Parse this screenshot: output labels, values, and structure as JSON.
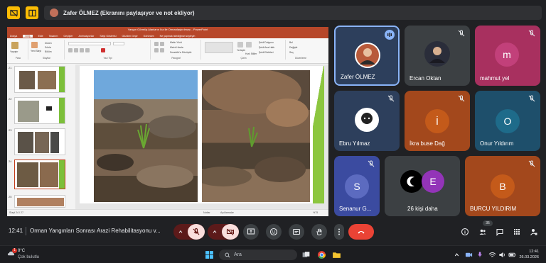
{
  "presenter_banner": {
    "text": "Zafer ÖLMEZ (Ekranını paylaşıyor ve not ekliyor)"
  },
  "presentation": {
    "window_title": "Yangın Görmüş Alanların Ilıa ile Ormanlaştırılması - PowerPoint",
    "tabs": [
      "Dosya",
      "Giriş",
      "Ekle",
      "Tasarım",
      "Geçişler",
      "Animasyonlar",
      "Slayt Gösterisi",
      "Gözden Geçir",
      "Görünüm",
      "Ne yapmak istediğinizi söyleyin"
    ],
    "ribbon": {
      "groups": [
        "Pano",
        "Slaytlar",
        "Yazı Tipi",
        "Paragraf",
        "Çizim",
        "Düzenleme"
      ],
      "items": [
        "Yapıştır",
        "Yeni Slayt",
        "Düzen",
        "Sıfırla",
        "Bölüm",
        "Metin Yönü",
        "Metni Hizala",
        "SmartArt'a Dönüştür",
        "Şekil Dolgusu",
        "Şekil Ana Hattı",
        "Şekil Efektleri",
        "Hızlı Stiller",
        "Yerleştir",
        "Bul",
        "Değiştir",
        "Seç"
      ]
    },
    "thumbnails": [
      {
        "num": "21"
      },
      {
        "num": "22"
      },
      {
        "num": "23"
      },
      {
        "num": "24"
      },
      {
        "num": "25"
      }
    ],
    "status": {
      "slide": "Slayt 24 / 27",
      "notes": "Notlar",
      "comments": "Açıklamalar",
      "zoom": "%75"
    }
  },
  "participants": [
    {
      "name": "Zafer ÖLMEZ",
      "initial": "",
      "color": "#2d3f5c",
      "avatar_color": "#b85a3a",
      "speaking": true
    },
    {
      "name": "Ercan Oktan",
      "initial": "",
      "color": "#3c4043",
      "avatar_color": "#2a2d3a",
      "speaking": false
    },
    {
      "name": "mahmut yel",
      "initial": "m",
      "color": "#a8305f",
      "avatar_color": "#a8305f",
      "speaking": false
    },
    {
      "name": "Ebru Yılmaz",
      "initial": "",
      "color": "#2d3f5c",
      "avatar_color": "#ffffff",
      "speaking": false
    },
    {
      "name": "İkra buse Dağ",
      "initial": "İ",
      "color": "#a3481c",
      "avatar_color": "#c45a1a",
      "speaking": false
    },
    {
      "name": "Onur Yıldırım",
      "initial": "O",
      "color": "#1e4f6b",
      "avatar_color": "#1e6b8a",
      "speaking": false
    },
    {
      "name": "Senanur G...",
      "initial": "S",
      "color": "#3b4ba0",
      "avatar_color": "#5c6bc0",
      "speaking": false
    },
    {
      "name": "26 kişi daha",
      "initial": "E",
      "color": "#3c4043",
      "avatar_color": "#9334b8",
      "speaking": false
    },
    {
      "name": "BURCU YILDIRIM",
      "initial": "B",
      "color": "#a3481c",
      "avatar_color": "#c45a1a",
      "speaking": false
    }
  ],
  "controls": {
    "time": "12:41",
    "meeting_title": "Orman Yangınları Sonrası Arazi Rehabilitasyonu v...",
    "participant_count": "35"
  },
  "taskbar": {
    "temperature": "8°C",
    "weather": "Çok bulutlu",
    "search_placeholder": "Ara",
    "time": "12:41",
    "date": "26.03.2026",
    "weather_badge": "1"
  }
}
